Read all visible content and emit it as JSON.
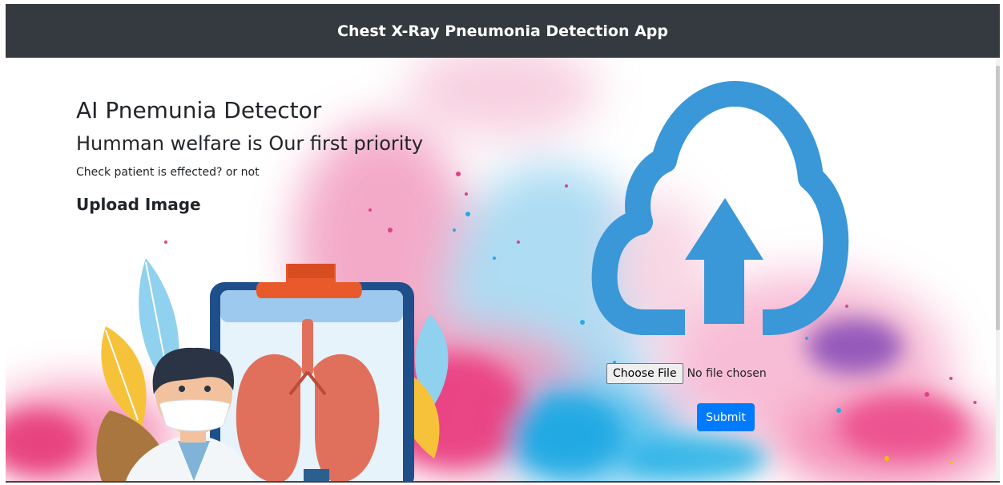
{
  "navbar": {
    "title": "Chest X-Ray Pneumonia Detection App"
  },
  "hero": {
    "title": "AI Pnemunia Detector",
    "subtitle": "Humman welfare is Our first priority",
    "description": "Check patient is effected? or not",
    "upload_heading": "Upload Image"
  },
  "upload": {
    "choose_file_label": "Choose File",
    "file_status": "No file chosen",
    "submit_label": "Submit"
  },
  "icons": {
    "upload": "cloud-upload-icon",
    "illustration": "doctor-lungs-clipboard-illustration"
  },
  "colors": {
    "navbar_bg": "#343a40",
    "cloud_blue": "#3a97d8",
    "submit_blue": "#007bff",
    "splash_pink": "#ef4a8c",
    "splash_cyan": "#29b6e8",
    "lungs": "#e0705c",
    "clipboard_frame": "#1f4f8a",
    "clip_orange": "#e85a2a"
  }
}
